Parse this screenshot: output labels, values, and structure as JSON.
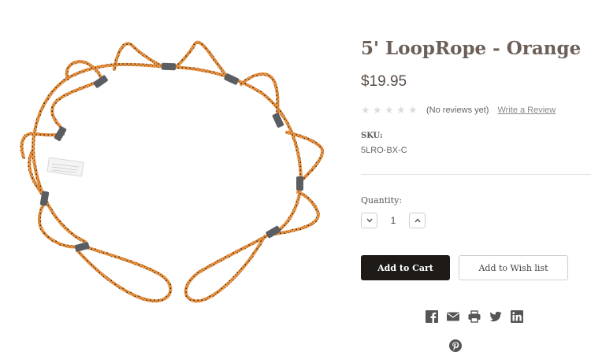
{
  "top_fragment": "' ' · ' ·",
  "product": {
    "title": "5' LoopRope - Orange",
    "price": "$19.95",
    "rating": {
      "stars_filled": 0,
      "stars_total": 5,
      "reviews_text": "(No reviews yet)",
      "write_review_label": "Write a Review"
    },
    "sku_label": "SKU:",
    "sku_value": "5LRO-BX-C",
    "quantity_label": "Quantity:",
    "quantity_value": "1",
    "add_to_cart_label": "Add to Cart",
    "add_to_wishlist_label": "Add to Wish list"
  },
  "share_icons": [
    "facebook-icon",
    "email-icon",
    "print-icon",
    "twitter-icon",
    "linkedin-icon",
    "pinterest-icon"
  ],
  "colors": {
    "rope_orange": "#e8923f",
    "sleeve_gray": "#5a5e62",
    "button_dark": "#1e1a18",
    "title_color": "#6b5f58",
    "star_empty": "#dcdcdc"
  }
}
